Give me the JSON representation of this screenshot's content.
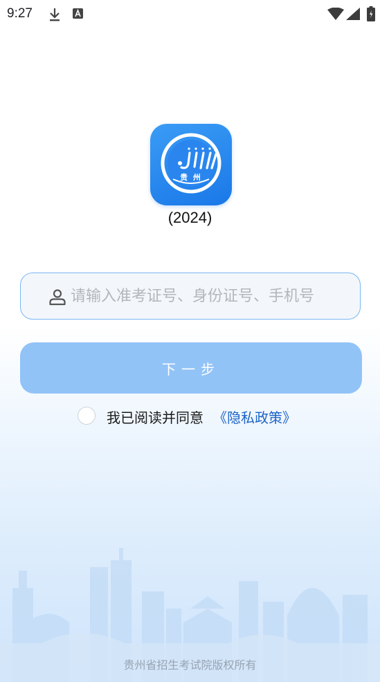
{
  "status_bar": {
    "time": "9:27",
    "left_icons": [
      "download-icon",
      "a-badge-icon"
    ],
    "right_icons": [
      "wifi-icon",
      "signal-icon",
      "battery-icon"
    ]
  },
  "app": {
    "logo_text": "贵 州",
    "version": "(2024)"
  },
  "login": {
    "input_placeholder": "请输入准考证号、身份证号、手机号",
    "input_value": "",
    "next_button_label": "下一步",
    "agree_text": "我已阅读并同意",
    "privacy_link": "《隐私政策》"
  },
  "footer": {
    "copyright": "贵州省招生考试院版权所有"
  },
  "colors": {
    "accent": "#1a78e8",
    "button": "#92c3f7",
    "link": "#1d64c8",
    "input_border": "#79b6f2"
  }
}
